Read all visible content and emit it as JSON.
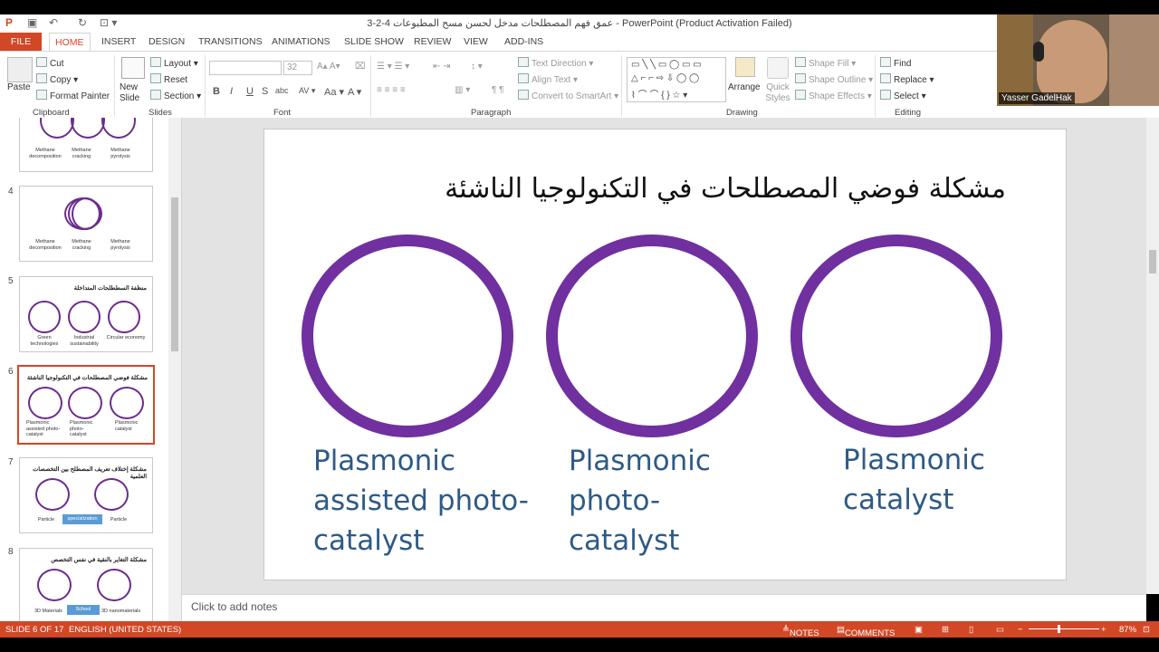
{
  "window": {
    "title": "3-2-4 عمق فهم المصطلحات مدخل لحسن مسح المطبوعات - PowerPoint (Product Activation Failed)"
  },
  "quick_access": {
    "save_icon": "save-icon",
    "undo_icon": "undo-icon",
    "redo_icon": "redo-icon"
  },
  "ribbon_tabs": [
    "FILE",
    "HOME",
    "INSERT",
    "DESIGN",
    "TRANSITIONS",
    "ANIMATIONS",
    "SLIDE SHOW",
    "REVIEW",
    "VIEW",
    "ADD-INS"
  ],
  "ribbon": {
    "clipboard": {
      "paste": "Paste",
      "cut": "Cut",
      "copy": "Copy",
      "format_painter": "Format Painter",
      "label": "Clipboard"
    },
    "slides": {
      "new_slide": "New Slide",
      "layout": "Layout",
      "reset": "Reset",
      "section": "Section",
      "label": "Slides"
    },
    "font": {
      "size": "32",
      "label": "Font"
    },
    "paragraph": {
      "text_direction": "Text Direction",
      "align_text": "Align Text",
      "smartart": "Convert to SmartArt",
      "label": "Paragraph"
    },
    "drawing": {
      "arrange": "Arrange",
      "quick_styles": "Quick Styles",
      "shape_fill": "Shape Fill",
      "shape_outline": "Shape Outline",
      "shape_effects": "Shape Effects",
      "label": "Drawing"
    },
    "editing": {
      "find": "Find",
      "replace": "Replace",
      "select": "Select",
      "label": "Editing"
    }
  },
  "webcam": {
    "name": "Yasser GadelHak"
  },
  "thumbnails": [
    {
      "num": "",
      "labels": [
        "Methane decomposition",
        "Methane cracking",
        "Methane pyrolysis"
      ]
    },
    {
      "num": "4",
      "labels": [
        "Methane decomposition",
        "Methane cracking",
        "Methane pyrolysis"
      ]
    },
    {
      "num": "5",
      "title": "منظفة السططلحات المتداخلة",
      "labels": [
        "Green technologies",
        "Industrial sustainability",
        "Circular economy"
      ]
    },
    {
      "num": "6",
      "title": "مشكلة فوضي المصطلحات في التكنولوجيا الناشئة",
      "labels": [
        "Plasmonic assisted photo-catalyst",
        "Plasmonic photo-catalyst",
        "Plasmonic catalyst"
      ]
    },
    {
      "num": "7",
      "title": "مشكلة إختلاف تعريف المصطلح بين التخصصات العلمية",
      "labels": [
        "Particle",
        "Particle"
      ],
      "arrow": "specialization"
    },
    {
      "num": "8",
      "title": "مشكلة التغاير بالنقية في نفس التخصص",
      "labels": [
        "3D Materials",
        "3D nanomaterials"
      ],
      "arrow": "School"
    }
  ],
  "slide": {
    "title": "مشكلة فوضي المصطلحات في التكنولوجيا الناشئة",
    "captions": [
      "Plasmonic assisted photo-catalyst",
      "Plasmonic photo-catalyst",
      "Plasmonic catalyst"
    ],
    "caption_lines": [
      [
        "Plasmonic",
        "assisted photo-",
        "catalyst"
      ],
      [
        "Plasmonic",
        "photo-",
        "catalyst"
      ],
      [
        "Plasmonic",
        "catalyst"
      ]
    ],
    "ring_color": "#7030a0",
    "caption_color": "#2e5a86"
  },
  "notes": {
    "placeholder": "Click to add notes"
  },
  "status": {
    "slide": "SLIDE 6 OF 17",
    "language": "ENGLISH (UNITED STATES)",
    "notes": "NOTES",
    "comments": "COMMENTS",
    "zoom": "87%"
  },
  "colors": {
    "accent": "#d24726"
  }
}
